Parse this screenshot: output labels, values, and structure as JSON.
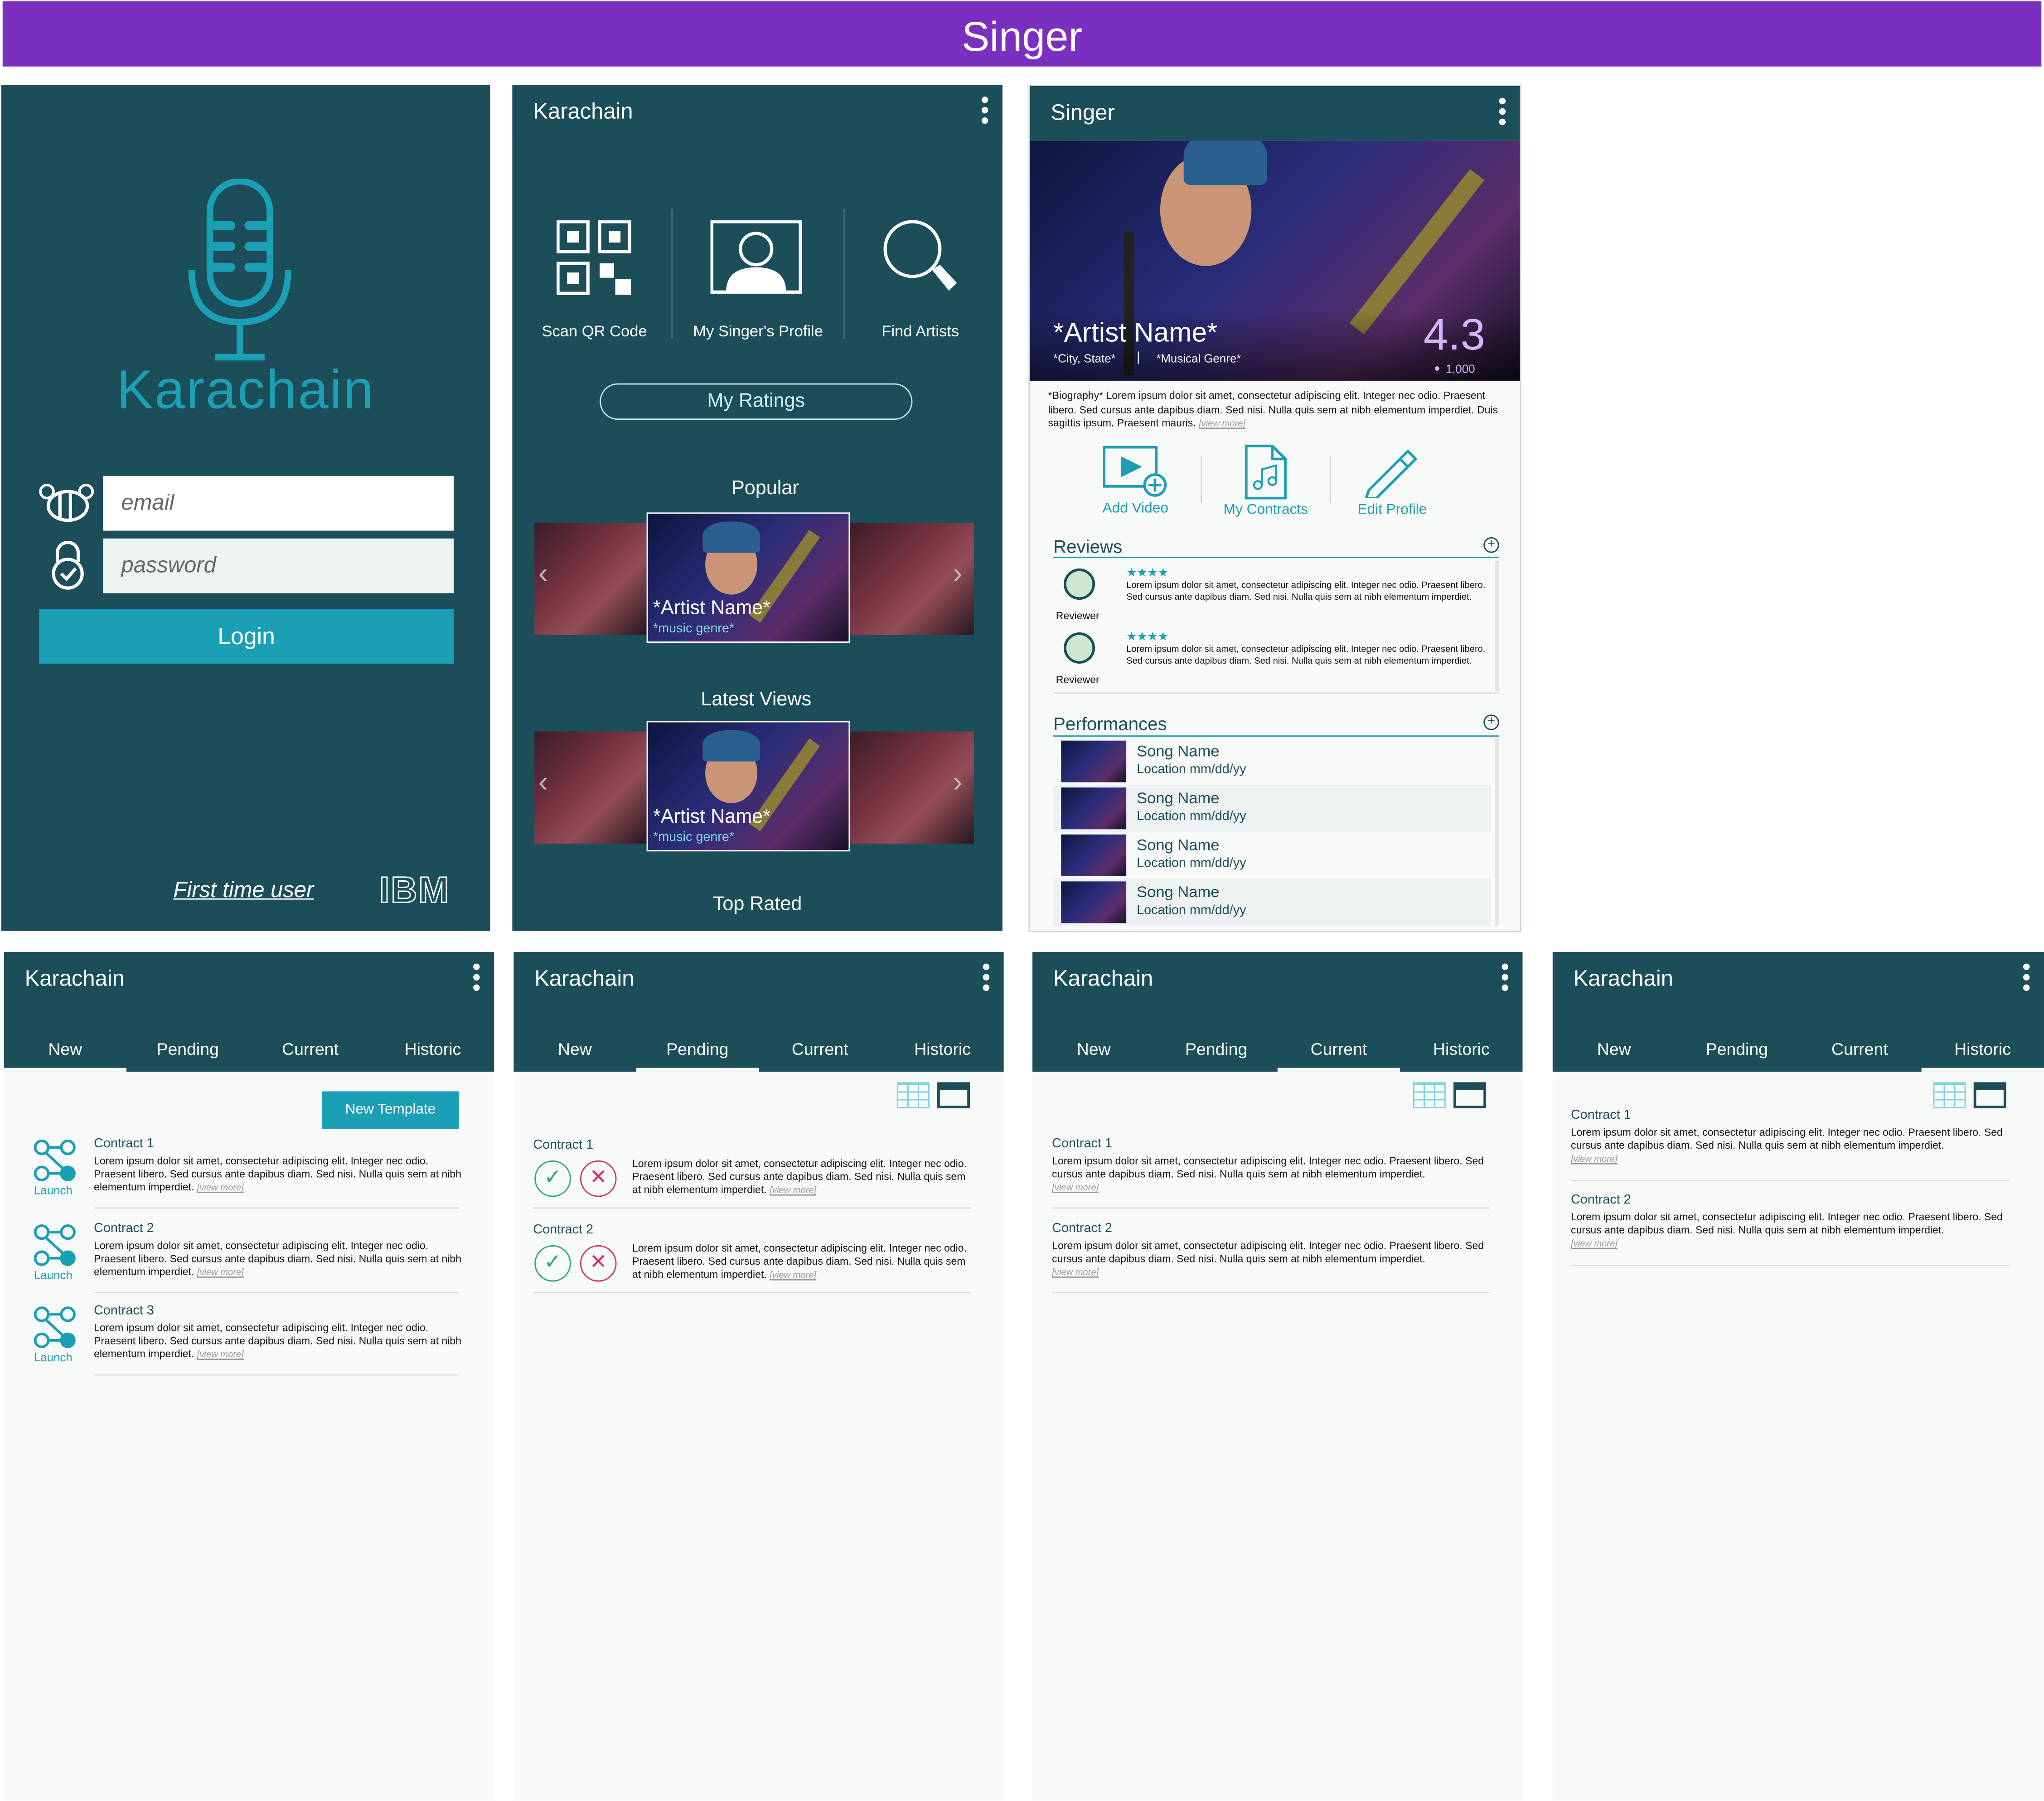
{
  "banner": "Singer",
  "login": {
    "brand": "Karachain",
    "email_placeholder": "email",
    "password_placeholder": "password",
    "login": "Login",
    "first_time": "First time user",
    "ibm": "IBM"
  },
  "home": {
    "title": "Karachain",
    "scan": "Scan QR Code",
    "profile": "My Singer's Profile",
    "find": "Find Artists",
    "ratings": "My Ratings",
    "popular": "Popular",
    "latest": "Latest Views",
    "top": "Top Rated",
    "card_artist": "*Artist Name*",
    "card_genre": "*music genre*"
  },
  "singer": {
    "title": "Singer",
    "artist": "*Artist Name*",
    "city": "*City, State*",
    "sep": "|",
    "genre": "*Musical Genre*",
    "rating": "4.3",
    "followers": "1,000",
    "bio": "*Biography* Lorem ipsum dolor sit amet, consectetur adipiscing elit. Integer nec odio. Praesent libero. Sed cursus ante dapibus diam. Sed nisi. Nulla quis sem at nibh elementum imperdiet. Duis sagittis ipsum. Praesent mauris.",
    "view_more": "[view more]",
    "add_video": "Add Video",
    "contracts": "My Contracts",
    "edit": "Edit Profile",
    "reviews": "Reviews",
    "review_list": [
      {
        "who": "Reviewer",
        "stars": "★★★★",
        "text": "Lorem ipsum dolor sit amet, consectetur adipiscing elit. Integer nec odio. Praesent libero. Sed cursus ante dapibus diam. Sed nisi. Nulla quis sem at nibh elementum imperdiet."
      },
      {
        "who": "Reviewer",
        "stars": "★★★★",
        "text": "Lorem ipsum dolor sit amet, consectetur adipiscing elit. Integer nec odio. Praesent libero. Sed cursus ante dapibus diam. Sed nisi. Nulla quis sem at nibh elementum imperdiet."
      }
    ],
    "performances": "Performances",
    "perf_list": [
      {
        "song": "Song Name",
        "loc": "Location   mm/dd/yy"
      },
      {
        "song": "Song Name",
        "loc": "Location   mm/dd/yy"
      },
      {
        "song": "Song Name",
        "loc": "Location   mm/dd/yy"
      },
      {
        "song": "Song Name",
        "loc": "Location   mm/dd/yy"
      }
    ]
  },
  "contracts": {
    "title": "Karachain",
    "tabs": [
      "New",
      "Pending",
      "Current",
      "Historic"
    ],
    "new_template": "New Template",
    "launch": "Launch",
    "c1": "Contract 1",
    "c2": "Contract 2",
    "c3": "Contract 3",
    "body": "Lorem ipsum dolor sit amet, consectetur adipiscing elit. Integer nec odio. Praesent libero. Sed cursus ante dapibus diam. Sed nisi. Nulla quis sem at nibh elementum imperdiet.",
    "view_more": "[view more]"
  },
  "colors": {
    "teal_dark": "#1b4e58",
    "accent": "#1a9fb5",
    "banner": "#7b2fbf",
    "rating": "#d7b4ff"
  },
  "icons": [
    "microphone-icon",
    "bee-icon",
    "lock-icon",
    "qr-code-icon",
    "profile-screen-icon",
    "search-icon",
    "add-video-icon",
    "music-file-icon",
    "pencil-icon",
    "avatar-icon",
    "plus-circle-icon",
    "flow-icon",
    "check-icon",
    "cross-icon",
    "grid-view-icon",
    "list-view-icon",
    "kebab-icon",
    "chevron-left-icon",
    "chevron-right-icon"
  ]
}
